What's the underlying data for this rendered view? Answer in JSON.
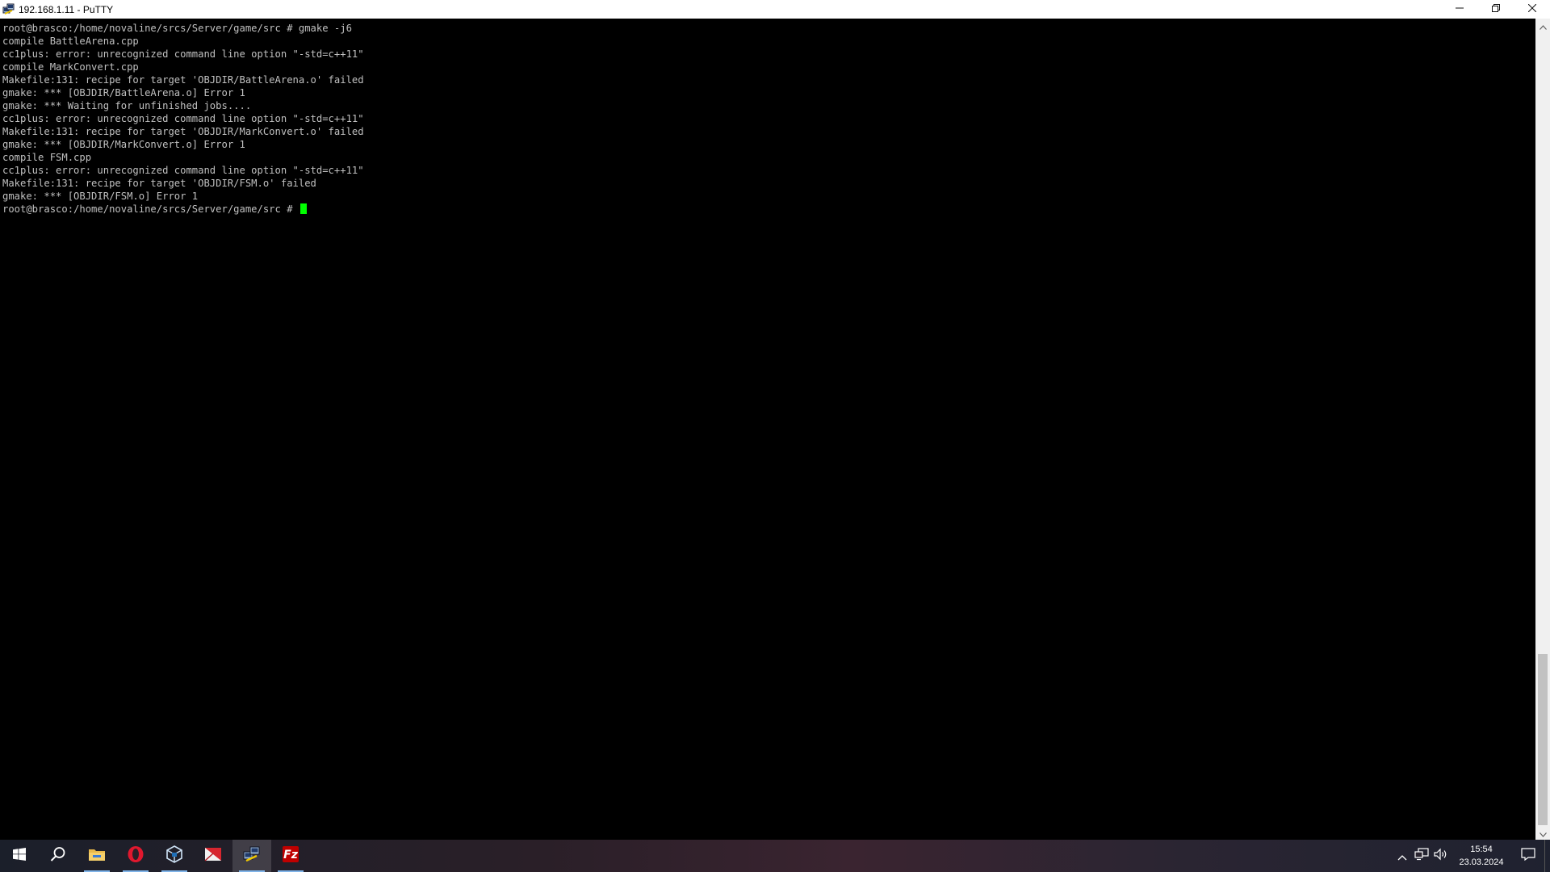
{
  "window": {
    "title": "192.168.1.11 - PuTTY",
    "icon": "putty-icon",
    "controls": [
      "minimize-icon",
      "restore-icon",
      "close-icon"
    ]
  },
  "terminal": {
    "lines": [
      "root@brasco:/home/novaline/srcs/Server/game/src # gmake -j6",
      "compile BattleArena.cpp",
      "cc1plus: error: unrecognized command line option \"-std=c++11\"",
      "compile MarkConvert.cpp",
      "Makefile:131: recipe for target 'OBJDIR/BattleArena.o' failed",
      "gmake: *** [OBJDIR/BattleArena.o] Error 1",
      "gmake: *** Waiting for unfinished jobs....",
      "cc1plus: error: unrecognized command line option \"-std=c++11\"",
      "Makefile:131: recipe for target 'OBJDIR/MarkConvert.o' failed",
      "gmake: *** [OBJDIR/MarkConvert.o] Error 1",
      "compile FSM.cpp",
      "cc1plus: error: unrecognized command line option \"-std=c++11\"",
      "Makefile:131: recipe for target 'OBJDIR/FSM.o' failed",
      "gmake: *** [OBJDIR/FSM.o] Error 1"
    ],
    "prompt": "root@brasco:/home/novaline/srcs/Server/game/src # ",
    "text_color": "#c0c0c0",
    "cursor_color": "#00ff00",
    "background": "#000000"
  },
  "taskbar": {
    "items": [
      {
        "name": "start-button",
        "icon": "windows-logo-icon"
      },
      {
        "name": "search-button",
        "icon": "search-icon"
      },
      {
        "name": "file-explorer-button",
        "icon": "folder-icon"
      },
      {
        "name": "opera-button",
        "icon": "opera-icon"
      },
      {
        "name": "virtualbox-button",
        "icon": "virtualbox-icon"
      },
      {
        "name": "mail-app-button",
        "icon": "mail-icon"
      },
      {
        "name": "putty-button",
        "icon": "putty-icon"
      },
      {
        "name": "filezilla-button",
        "icon": "filezilla-icon"
      }
    ],
    "tray": {
      "icons": [
        "chevron-up-icon",
        "network-icon",
        "volume-icon"
      ],
      "time": "15:54",
      "date": "23.03.2024",
      "notification_icon": "notification-icon"
    }
  }
}
